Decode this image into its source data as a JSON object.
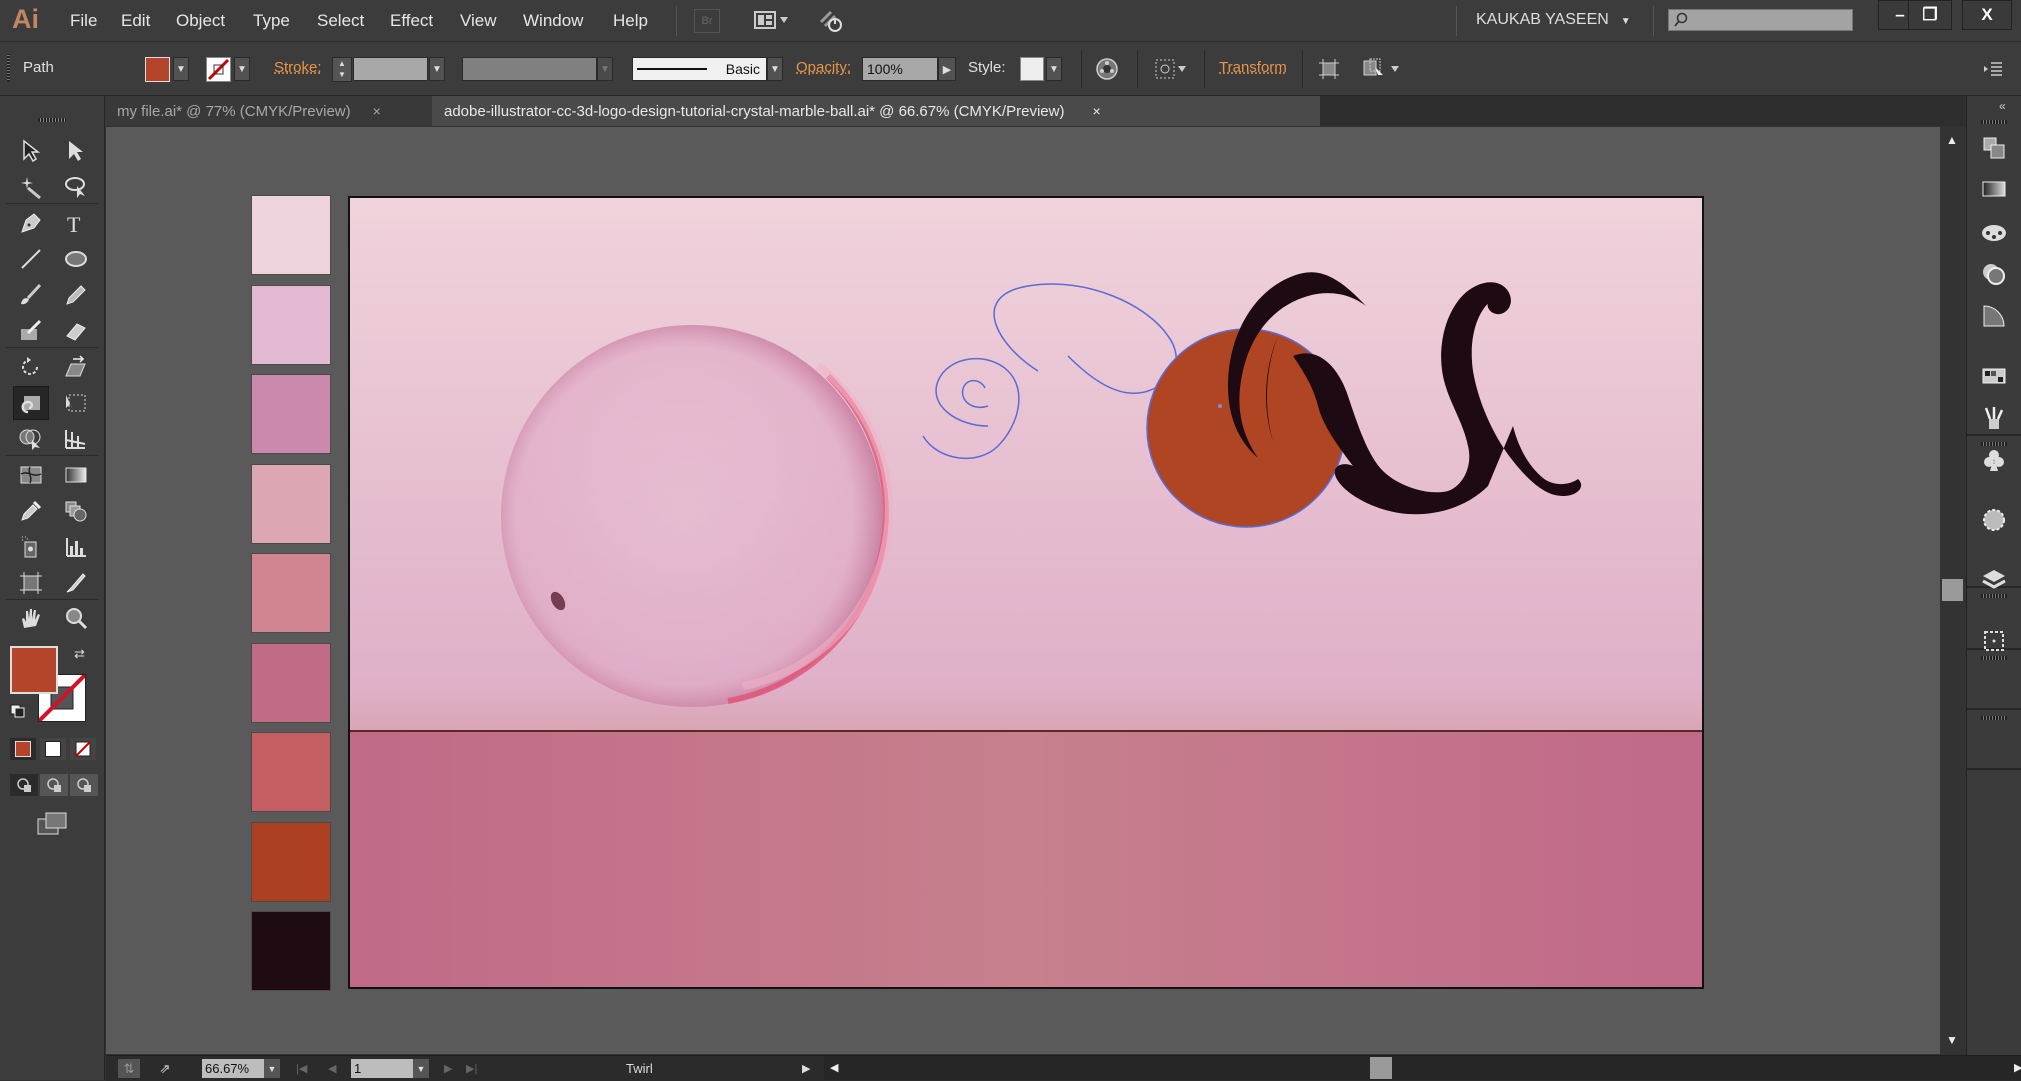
{
  "app": {
    "logo": "Ai",
    "menu": [
      "File",
      "Edit",
      "Object",
      "Type",
      "Select",
      "Effect",
      "View",
      "Window",
      "Help"
    ],
    "bridge_label": "Br",
    "user_name": "KAUKAB YASEEN",
    "search": {
      "value": "",
      "placeholder": ""
    },
    "window_buttons": {
      "minimize": "–",
      "restore": "❐",
      "close": "X"
    }
  },
  "control_bar": {
    "selection_type": "Path",
    "fill_color": "#b5452a",
    "stroke_label": "Stroke:",
    "stroke_weight": "",
    "variable_width": "",
    "brush_profile": "Basic",
    "opacity_label": "Opacity:",
    "opacity_value": "100%",
    "style_label": "Style:",
    "transform_label": "Transform"
  },
  "tabs": [
    {
      "label": "my file.ai* @ 77% (CMYK/Preview)",
      "active": false,
      "close": "×"
    },
    {
      "label": "adobe-illustrator-cc-3d-logo-design-tutorial-crystal-marble-ball.ai* @ 66.67% (CMYK/Preview)",
      "active": true,
      "close": "×"
    }
  ],
  "tools": [
    [
      "selection-tool",
      "direct-selection-tool"
    ],
    [
      "magic-wand-tool",
      "lasso-tool"
    ],
    [
      "pen-tool",
      "type-tool"
    ],
    [
      "line-segment-tool",
      "ellipse-tool"
    ],
    [
      "paintbrush-tool",
      "pencil-tool"
    ],
    [
      "blob-brush-tool",
      "eraser-tool"
    ],
    [
      "rotate-tool",
      "scale-tool"
    ],
    [
      "twirl-tool",
      "free-transform-tool"
    ],
    [
      "shape-builder-tool",
      "perspective-grid-tool"
    ],
    [
      "mesh-tool",
      "gradient-tool"
    ],
    [
      "eyedropper-tool",
      "blend-tool"
    ],
    [
      "symbol-sprayer-tool",
      "column-graph-tool"
    ],
    [
      "artboard-tool",
      "slice-tool"
    ],
    [
      "hand-tool",
      "zoom-tool"
    ]
  ],
  "active_tool": "twirl-tool",
  "fill_stroke": {
    "fill": "#b5452a",
    "stroke": "none"
  },
  "swatches": [
    "#efd3dc",
    "#e3b9d2",
    "#cb89ad",
    "#dca6b3",
    "#d18590",
    "#c26b86",
    "#c45e62",
    "#ad4023",
    "#1f0c13"
  ],
  "artboard": {
    "sky_top": "#f0d3db",
    "sky_bottom": "#dfb0c8",
    "ground": "#c3748a",
    "horizon_line": "#5a2a22",
    "orange_circle": "#b04523",
    "splash_color": "#1e0a12",
    "selection_color": "#5a6bd6"
  },
  "status_bar": {
    "zoom": "66.67%",
    "artboard_number": "1",
    "current_tool": "Twirl"
  },
  "right_dock": [
    "arrange-documents-icon",
    "gradient-panel-icon",
    "color-guide-icon",
    "transparency-icon",
    "appearance-icon",
    "swatches-icon",
    "brushes-icon",
    "symbols-icon",
    "graphic-styles-icon",
    "layers-icon",
    "artboards-icon"
  ]
}
